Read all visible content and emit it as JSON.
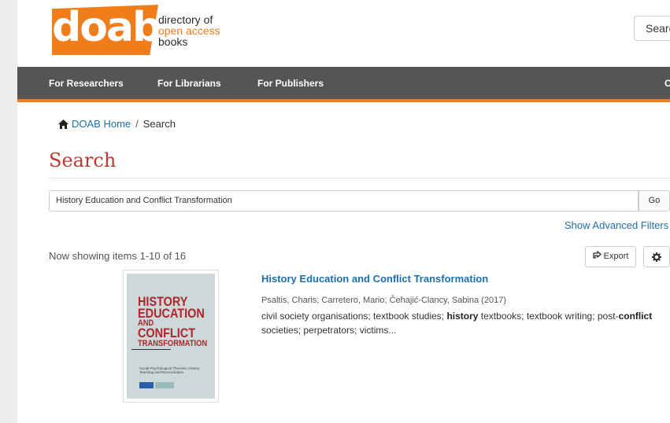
{
  "header": {
    "logo_text": "doab",
    "tagline": [
      "directory of",
      "open access",
      "books"
    ],
    "search_button": "Searc"
  },
  "nav": {
    "items": [
      "For Researchers",
      "For Librarians",
      "For Publishers"
    ],
    "cut_item": "C"
  },
  "breadcrumb": {
    "home": "DOAB Home",
    "separator": "/",
    "current": "Search"
  },
  "page_title": "Search",
  "search": {
    "query": "History Education and Conflict Transformation",
    "go_label": "Go",
    "advanced_filters": "Show Advanced Filters"
  },
  "results": {
    "summary": "Now showing items 1-10 of 16",
    "export_label": "Export",
    "items": [
      {
        "title": "History Education and Conflict Transformation",
        "authors": "Psaltis, Charis; Carretero, Mario; Čehajić-Clancy, Sabina (2017)",
        "abstract_parts": [
          {
            "text": "civil society organisations; textbook studies; ",
            "bold": false
          },
          {
            "text": "history",
            "bold": true
          },
          {
            "text": " textbooks; textbook writing; post-",
            "bold": false
          },
          {
            "text": "conflict",
            "bold": true
          },
          {
            "text": " societies; perpetrators; victims...",
            "bold": false
          }
        ],
        "cover": {
          "title_lines": [
            "HISTORY",
            "EDUCATION",
            "AND",
            "CONFLICT",
            "TRANSFORMATION"
          ],
          "subtitle": "Social Psychological Theories, History Teaching and Reconciliation"
        }
      }
    ]
  },
  "colors": {
    "brand_orange": "#f07d19",
    "nav_gray": "#555555",
    "link_blue": "#1e6fa8",
    "title_red": "#b83a32"
  }
}
